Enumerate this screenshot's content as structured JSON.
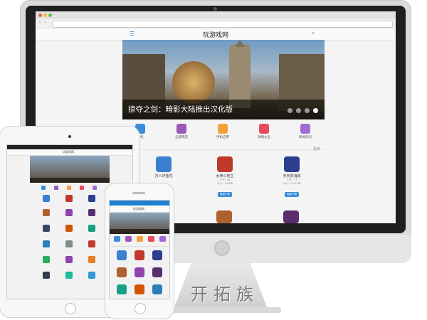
{
  "site": {
    "title": "玩游戏网",
    "banner_caption": "掠夺之剑：暗影大陆推出汉化版",
    "more_label": "更多",
    "categories": [
      {
        "label": "单机",
        "color": "#3a8bd8"
      },
      {
        "label": "全部网游",
        "color": "#9b59b6"
      },
      {
        "label": "手机应用",
        "color": "#f1a33a"
      },
      {
        "label": "攻略大全",
        "color": "#e74c5c"
      },
      {
        "label": "新闻资讯",
        "color": "#a06bd1"
      }
    ],
    "games": [
      {
        "name": "万人炸金花",
        "meta1": "",
        "meta2": "",
        "button": "",
        "color": "#3b7fd1"
      },
      {
        "name": "女神斗地主",
        "meta1": "人气：56",
        "meta2": "大小：4.8 MB",
        "button": "极速下载",
        "color": "#c0392b"
      },
      {
        "name": "天天爱消除",
        "meta1": "人气：73",
        "meta2": "大小：12.27 MB",
        "button": "极速下载",
        "color": "#2c3e8f"
      }
    ]
  },
  "watermark": "开拓族",
  "icons": {
    "menu": "menu-icon",
    "search": "search-icon"
  }
}
